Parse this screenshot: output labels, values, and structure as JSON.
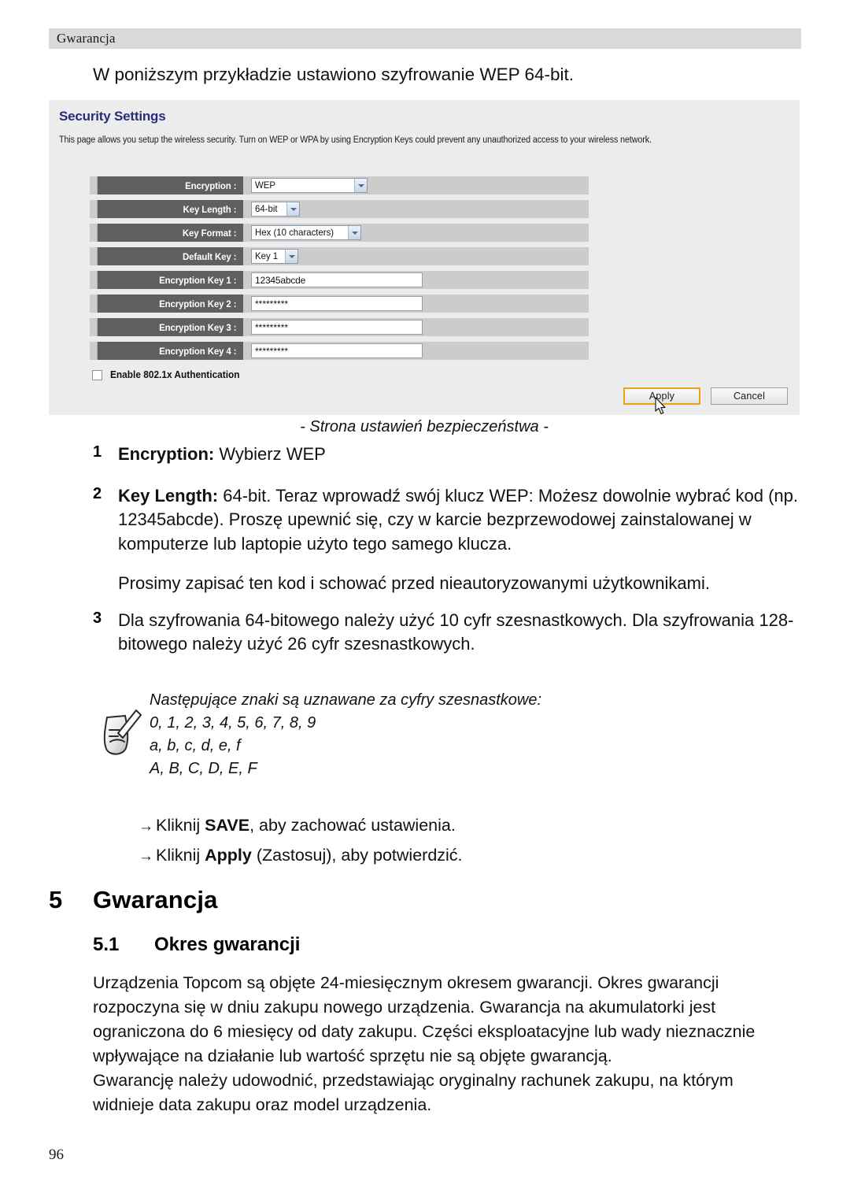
{
  "page": {
    "running_header": "Gwarancja",
    "page_number": "96",
    "intro_line": "W poniższym przykładzie ustawiono szyfrowanie WEP 64-bit."
  },
  "router_ui": {
    "panel_title": "Security Settings",
    "panel_description": "This page allows you setup the wireless security. Turn on WEP or WPA by using Encryption Keys could prevent any unauthorized access to your wireless network.",
    "fields": [
      {
        "label": "Encryption :",
        "type": "select",
        "value": "WEP"
      },
      {
        "label": "Key Length :",
        "type": "select",
        "value": "64-bit"
      },
      {
        "label": "Key Format :",
        "type": "select",
        "value": "Hex (10 characters)"
      },
      {
        "label": "Default Key :",
        "type": "select",
        "value": "Key 1"
      },
      {
        "label": "Encryption Key 1 :",
        "type": "text",
        "value": "12345abcde"
      },
      {
        "label": "Encryption Key 2 :",
        "type": "text",
        "value": "*********"
      },
      {
        "label": "Encryption Key 3 :",
        "type": "text",
        "value": "*********"
      },
      {
        "label": "Encryption Key 4 :",
        "type": "text",
        "value": "*********"
      }
    ],
    "checkbox_label": "Enable 802.1x Authentication",
    "checkbox_checked": false,
    "apply_label": "Apply",
    "cancel_label": "Cancel",
    "accent_apply_border": "#e8a317",
    "title_color": "#2b2b7a",
    "panel_bg": "#ececec",
    "label_cell_bg": "#5f5f5f",
    "row_bg": "#cccccc"
  },
  "caption": "- Strona ustawień bezpieczeństwa -",
  "numbered_list": [
    {
      "num": "1",
      "bold": "Encryption:",
      "rest": " Wybierz WEP"
    },
    {
      "num": "2",
      "bold": "Key Length:",
      "rest": " 64-bit. Teraz wprowadź swój klucz WEP: Możesz dowolnie wybrać kod (np. 12345abcde). Proszę upewnić się, czy w karcie bezprzewodowej zainstalowanej w komputerze lub laptopie użyto tego samego klucza."
    }
  ],
  "sub_paragraph": "Prosimy zapisać ten kod i schować przed nieautoryzowanymi użytkownikami.",
  "numbered_item_3": {
    "num": "3",
    "text": "Dla szyfrowania 64-bitowego należy użyć 10 cyfr szesnastkowych. Dla szyfrowania 128-bitowego należy użyć 26 cyfr szesnastkowych."
  },
  "note": {
    "icon": "note-pencil-icon",
    "heading": "Następujące znaki są uznawane za cyfry szesnastkowe:",
    "line_digits": "0, 1, 2, 3, 4, 5, 6, 7, 8, 9",
    "line_lower": " a, b, c, d, e, f",
    "line_upper": "A, B, C, D, E, F"
  },
  "arrow_bullets": [
    {
      "arrow": "→",
      "pre": "Kliknij ",
      "bold": "SAVE",
      "post": ", aby zachować ustawienia."
    },
    {
      "arrow": "→",
      "pre": "Kliknij ",
      "bold": "Apply",
      "post": " (Zastosuj), aby potwierdzić."
    }
  ],
  "headings": {
    "h1_number": "5",
    "h1_title": "Gwarancja",
    "h2_number": "5.1",
    "h2_title": "Okres gwarancji"
  },
  "body": {
    "paragraph_1": "Urządzenia Topcom są objęte 24-miesięcznym okresem gwarancji. Okres gwarancji rozpoczyna się w dniu zakupu nowego urządzenia. Gwarancja na akumulatorki jest ograniczona do 6 miesięcy od daty zakupu. Części eksploatacyjne lub wady nieznacznie wpływające na działanie lub wartość sprzętu nie są objęte gwarancją.",
    "paragraph_2": "Gwarancję należy udowodnić, przedstawiając oryginalny rachunek zakupu, na którym widnieje data zakupu oraz model urządzenia."
  }
}
